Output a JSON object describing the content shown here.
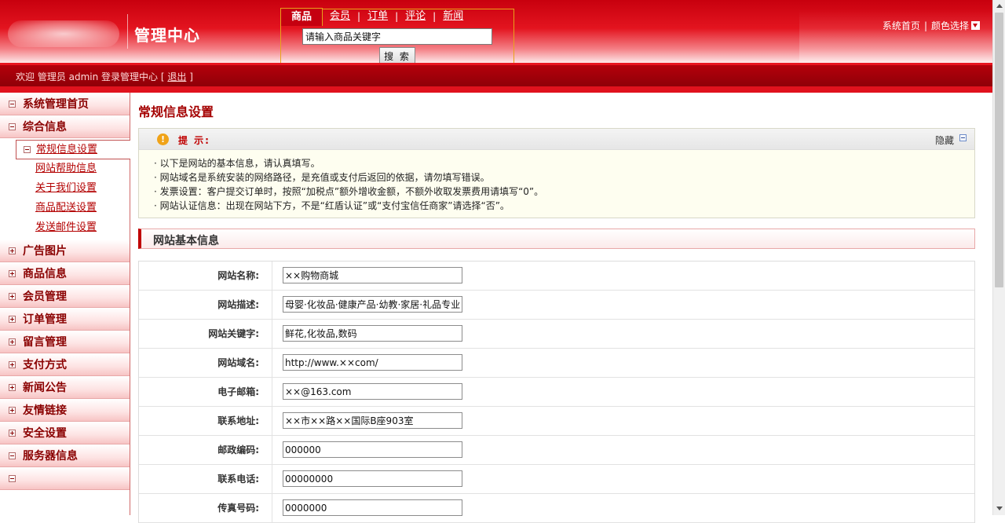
{
  "header": {
    "title": "管理中心",
    "search_tabs": [
      {
        "label": "商品",
        "active": true
      },
      {
        "label": "会员",
        "active": false
      },
      {
        "label": "订单",
        "active": false
      },
      {
        "label": "评论",
        "active": false
      },
      {
        "label": "新闻",
        "active": false
      }
    ],
    "search_value": "请输入商品关键字",
    "search_button": "搜 索",
    "links": {
      "home": "系统首页",
      "color": "颜色选择"
    }
  },
  "welcome": {
    "prefix": "欢迎 管理员 admin 登录管理中心 [ ",
    "logout": "退出",
    "suffix": " ]"
  },
  "sidebar": {
    "groups": [
      {
        "label": "系统管理首页",
        "expanded": false,
        "icon": "minus"
      },
      {
        "label": "综合信息",
        "expanded": true,
        "icon": "minus",
        "items": [
          {
            "label": "常规信息设置",
            "active": true
          },
          {
            "label": "网站帮助信息",
            "active": false
          },
          {
            "label": "关于我们设置",
            "active": false
          },
          {
            "label": "商品配送设置",
            "active": false
          },
          {
            "label": "发送邮件设置",
            "active": false
          }
        ]
      },
      {
        "label": "广告图片",
        "icon": "plus"
      },
      {
        "label": "商品信息",
        "icon": "plus"
      },
      {
        "label": "会员管理",
        "icon": "plus"
      },
      {
        "label": "订单管理",
        "icon": "plus"
      },
      {
        "label": "留言管理",
        "icon": "plus"
      },
      {
        "label": "支付方式",
        "icon": "plus"
      },
      {
        "label": "新闻公告",
        "icon": "plus"
      },
      {
        "label": "友情链接",
        "icon": "plus"
      },
      {
        "label": "安全设置",
        "icon": "plus"
      },
      {
        "label": "服务器信息",
        "icon": "minus"
      },
      {
        "label": "",
        "icon": "minus"
      }
    ]
  },
  "main": {
    "page_title": "常规信息设置",
    "tip": {
      "label": "提 示:",
      "hide": "隐藏",
      "lines": [
        "· 以下是网站的基本信息，请认真填写。",
        "· 网站域名是系统安装的网络路径，是充值或支付后返回的依据，请勿填写错误。",
        "· 发票设置：客户提交订单时，按照“加税点”额外增收金额，不额外收取发票费用请填写“0”。",
        "· 网站认证信息：出现在网站下方，不是“红盾认证”或“支付宝信任商家”请选择“否”。"
      ]
    },
    "section_title": "网站基本信息",
    "fields": [
      {
        "label": "网站名称:",
        "value": "××购物商城"
      },
      {
        "label": "网站描述:",
        "value": "母婴·化妆品·健康产品·幼教·家居·礼品专业"
      },
      {
        "label": "网站关键字:",
        "value": "鲜花,化妆品,数码"
      },
      {
        "label": "网站域名:",
        "value": "http://www.××com/"
      },
      {
        "label": "电子邮箱:",
        "value": "××@163.com"
      },
      {
        "label": "联系地址:",
        "value": "××市××路××国际B座903室"
      },
      {
        "label": "邮政编码:",
        "value": "000000"
      },
      {
        "label": "联系电话:",
        "value": "00000000"
      },
      {
        "label": "传真号码:",
        "value": "0000000"
      }
    ]
  },
  "colors": {
    "brand_red": "#c8000e",
    "dark_red": "#8a0000",
    "accent_orange": "#e8a21a"
  }
}
